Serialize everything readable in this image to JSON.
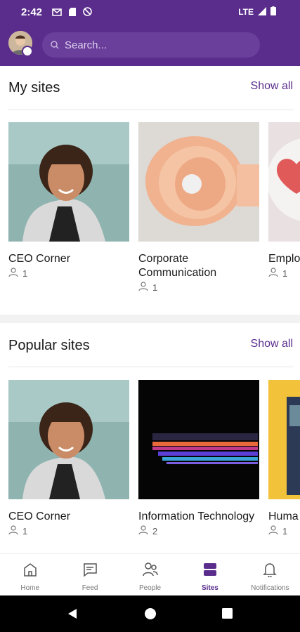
{
  "status_bar": {
    "time": "2:42",
    "network": "LTE"
  },
  "search": {
    "placeholder": "Search..."
  },
  "my_sites": {
    "title": "My sites",
    "show_all": "Show all",
    "cards": [
      {
        "title": "CEO Corner",
        "members": "1"
      },
      {
        "title": "Corporate Communication",
        "members": "1"
      },
      {
        "title": "Emplo",
        "members": "1"
      }
    ]
  },
  "popular_sites": {
    "title": "Popular sites",
    "show_all": "Show all",
    "cards": [
      {
        "title": "CEO Corner",
        "members": "1"
      },
      {
        "title": "Information Technology",
        "members": "2"
      },
      {
        "title": "Huma",
        "members": "1"
      }
    ]
  },
  "nav": [
    {
      "label": "Home",
      "icon": "home-icon"
    },
    {
      "label": "Feed",
      "icon": "feed-icon"
    },
    {
      "label": "People",
      "icon": "people-icon"
    },
    {
      "label": "Sites",
      "icon": "sites-icon",
      "active": true
    },
    {
      "label": "Notifications",
      "icon": "bell-icon"
    }
  ],
  "colors": {
    "brand": "#5a2d8c"
  }
}
